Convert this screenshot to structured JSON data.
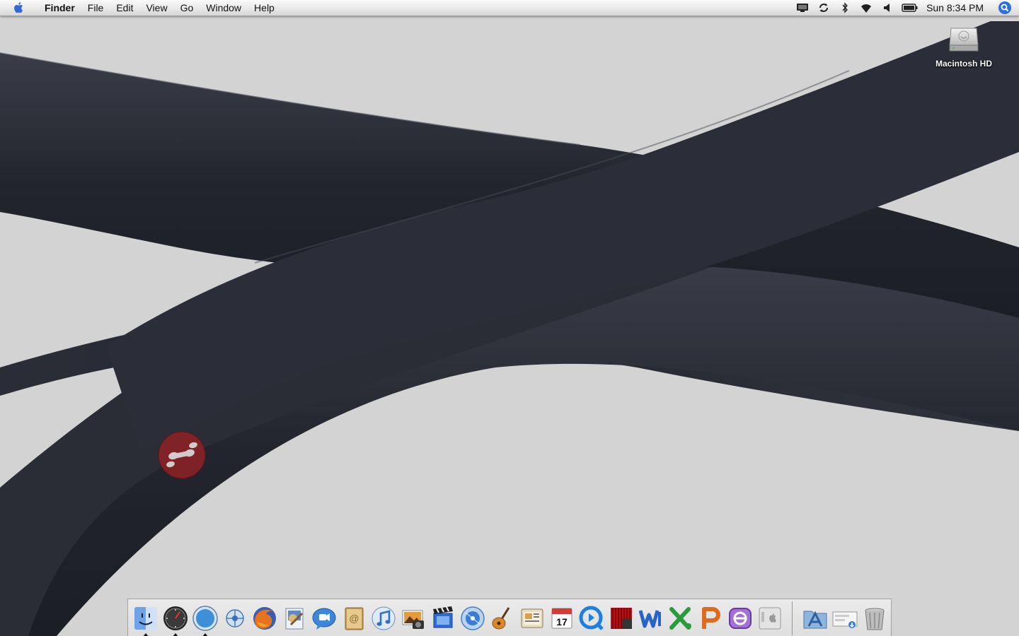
{
  "menubar": {
    "apple_icon": "apple-logo-icon",
    "app_name": "Finder",
    "menus": [
      "File",
      "Edit",
      "View",
      "Go",
      "Window",
      "Help"
    ],
    "status_icons": [
      "display-icon",
      "sync-icon",
      "bluetooth-icon",
      "wifi-icon",
      "volume-icon",
      "battery-icon"
    ],
    "clock": "Sun 8:34 PM",
    "spotlight_icon": "spotlight-icon"
  },
  "desktop": {
    "wallpaper_color": "#d3d3d3",
    "ribbon_color": "#2b2d37",
    "icons": [
      {
        "label": "Macintosh HD",
        "icon": "hard-drive-icon"
      }
    ],
    "widget_icon": "red-badge-icon"
  },
  "dock": {
    "apps": [
      {
        "name": "Finder",
        "icon": "finder-icon",
        "running": true
      },
      {
        "name": "Dashboard",
        "icon": "dashboard-icon",
        "running": true
      },
      {
        "name": "Safari",
        "icon": "safari-icon",
        "running": true
      },
      {
        "name": "Network Utility",
        "icon": "network-icon",
        "running": false
      },
      {
        "name": "Firefox",
        "icon": "firefox-icon",
        "running": false
      },
      {
        "name": "Preview",
        "icon": "preview-icon",
        "running": false
      },
      {
        "name": "iChat",
        "icon": "ichat-icon",
        "running": false
      },
      {
        "name": "Address Book",
        "icon": "address-book-icon",
        "running": false
      },
      {
        "name": "iTunes",
        "icon": "itunes-icon",
        "running": false
      },
      {
        "name": "iPhoto",
        "icon": "iphoto-icon",
        "running": false
      },
      {
        "name": "iMovie",
        "icon": "imovie-icon",
        "running": false
      },
      {
        "name": "iDVD",
        "icon": "idvd-icon",
        "running": false
      },
      {
        "name": "GarageBand",
        "icon": "garageband-icon",
        "running": false
      },
      {
        "name": "iWeb",
        "icon": "iweb-icon",
        "running": false
      },
      {
        "name": "iCal",
        "icon": "ical-icon",
        "running": false
      },
      {
        "name": "QuickTime",
        "icon": "quicktime-icon",
        "running": false
      },
      {
        "name": "Front Row",
        "icon": "front-row-icon",
        "running": false
      },
      {
        "name": "Word",
        "icon": "word-icon",
        "running": false
      },
      {
        "name": "Excel",
        "icon": "excel-icon",
        "running": false
      },
      {
        "name": "PowerPoint",
        "icon": "powerpoint-icon",
        "running": false
      },
      {
        "name": "Entourage",
        "icon": "entourage-icon",
        "running": false
      },
      {
        "name": "System Preferences",
        "icon": "system-prefs-icon",
        "running": false
      }
    ],
    "calendar_day": "17",
    "stacks": [
      {
        "name": "Applications",
        "icon": "applications-folder-icon"
      },
      {
        "name": "Downloads",
        "icon": "downloads-icon"
      },
      {
        "name": "Trash",
        "icon": "trash-icon"
      }
    ]
  }
}
